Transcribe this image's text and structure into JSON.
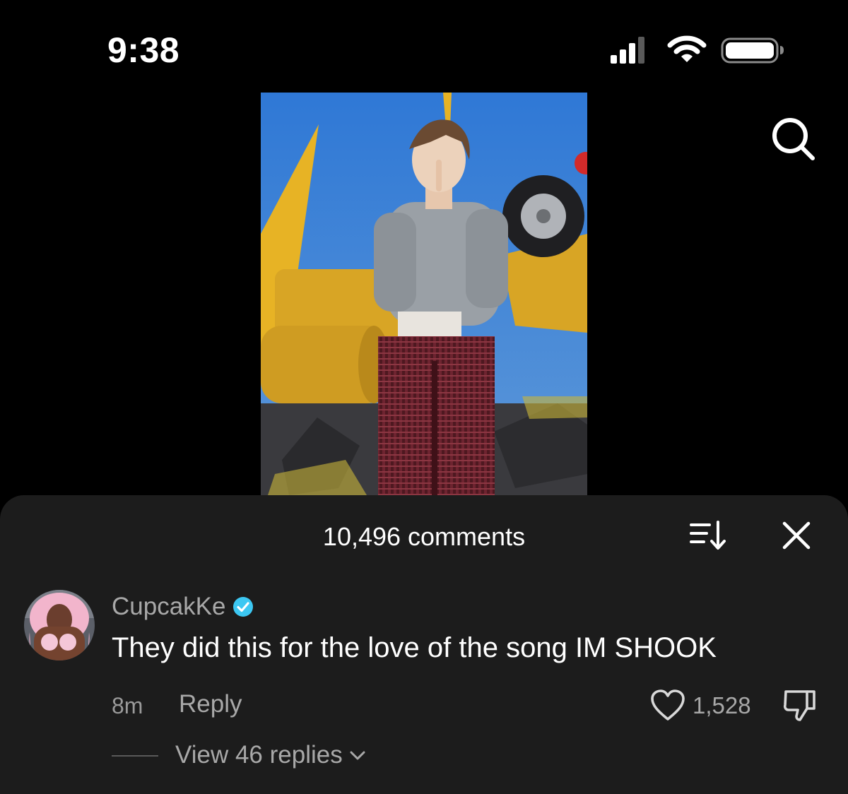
{
  "status_bar": {
    "time": "9:38"
  },
  "comments_panel": {
    "count_label": "10,496 comments"
  },
  "comment": {
    "username": "CupcakKe",
    "verified": true,
    "text": "They did this for the love of the song IM SHOOK",
    "time_ago": "8m",
    "reply_label": "Reply",
    "like_count": "1,528",
    "view_replies_label": "View 46 replies"
  },
  "colors": {
    "background": "#000000",
    "sheet": "#1c1c1c",
    "secondary_text": "#a8a8a8",
    "verified_badge": "#3cc7f2"
  },
  "icons": {
    "signal": "signal-icon",
    "wifi": "wifi-icon",
    "battery": "battery-icon",
    "search": "search-icon",
    "sort": "sort-icon",
    "close": "close-icon",
    "verified": "verified-icon",
    "heart": "heart-icon",
    "dislike": "dislike-icon",
    "chevron": "chevron-down-icon"
  }
}
